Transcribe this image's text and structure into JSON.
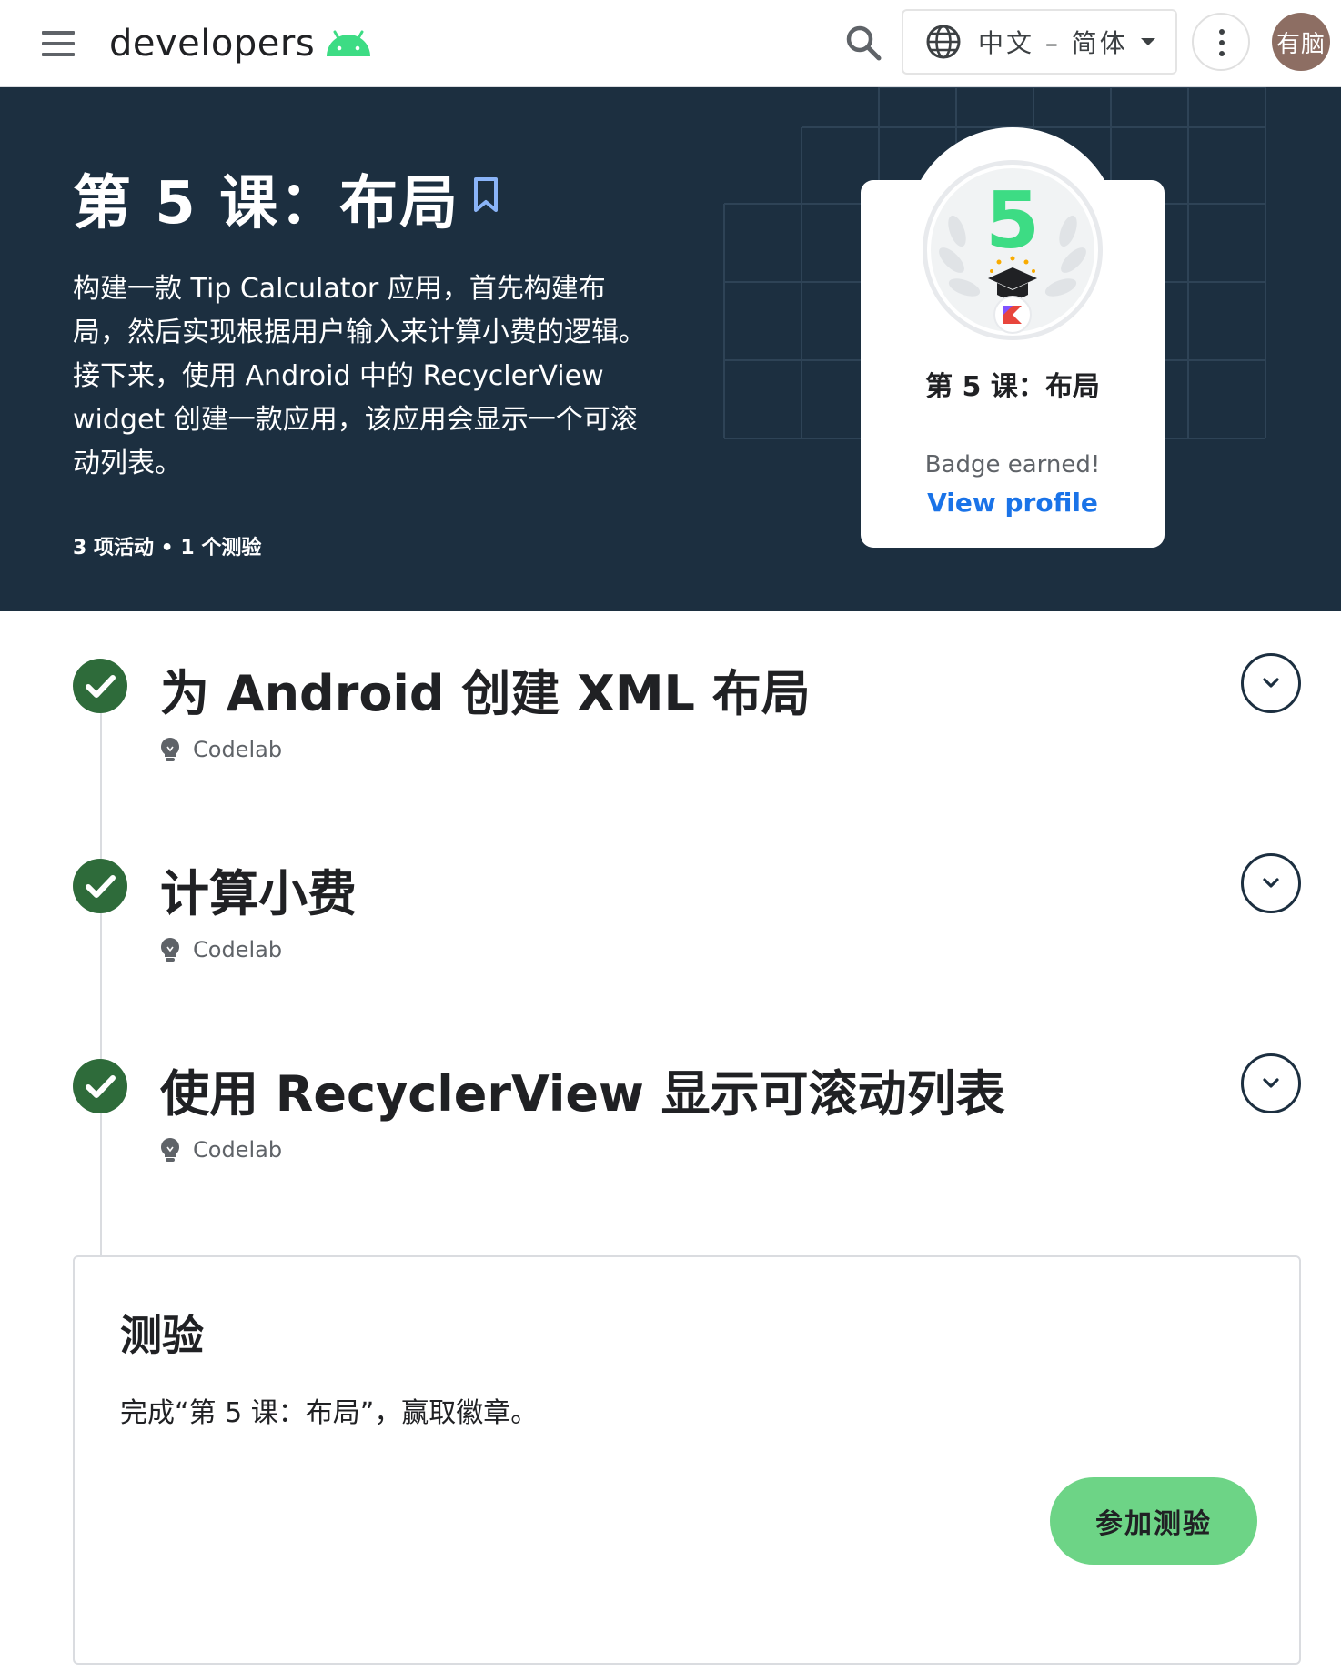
{
  "header": {
    "logo_text": "developers",
    "logo_icon": "android-head-icon",
    "search_icon": "search-icon",
    "language": "中文 – 简体",
    "language_icon": "globe-icon",
    "more_icon": "more-vert-icon",
    "avatar_text": "有脑"
  },
  "hero": {
    "title": "第 5 课：布局",
    "bookmark_icon": "bookmark-icon",
    "description": "构建一款 Tip Calculator 应用，首先构建布局，然后实现根据用户输入来计算小费的逻辑。接下来，使用 Android 中的 RecyclerView widget 创建一款应用，该应用会显示一个可滚动列表。",
    "meta": "3 项活动 • 1 个测验",
    "badge": {
      "number": "5",
      "name": "第 5 课：布局",
      "earned": "Badge earned!",
      "view_profile": "View profile"
    }
  },
  "activities": [
    {
      "title": "为 Android 创建 XML 布局",
      "type": "Codelab",
      "completed": true
    },
    {
      "title": "计算小费",
      "type": "Codelab",
      "completed": true
    },
    {
      "title": "使用 RecyclerView 显示可滚动列表",
      "type": "Codelab",
      "completed": true
    }
  ],
  "quiz": {
    "title": "测验",
    "description": "完成“第 5 课：布局”，赢取徽章。",
    "button": "参加测验"
  },
  "colors": {
    "hero_bg": "#1c2f40",
    "check_green": "#2e6b3a",
    "link_blue": "#1a73e8",
    "quiz_button": "#6dd486",
    "android_green": "#3ddc84"
  }
}
